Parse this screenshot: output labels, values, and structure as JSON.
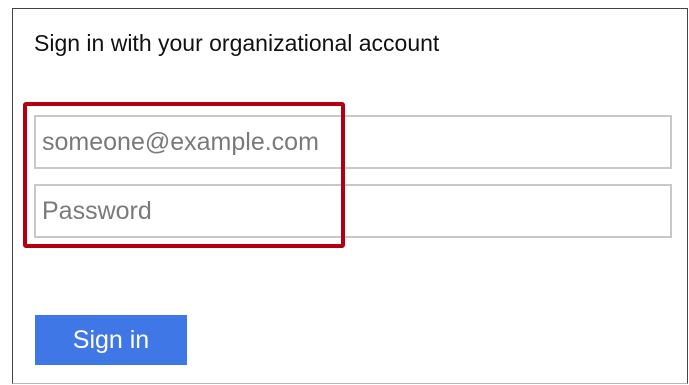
{
  "login": {
    "heading": "Sign in with your organizational account",
    "email_field": {
      "value": "",
      "placeholder": "someone@example.com"
    },
    "password_field": {
      "value": "",
      "placeholder": "Password"
    },
    "submit_label": "Sign in"
  },
  "colors": {
    "highlight_border": "#b30010",
    "button_background": "#3f78e6",
    "button_text": "#ffffff",
    "field_border": "#c8c8c8"
  }
}
